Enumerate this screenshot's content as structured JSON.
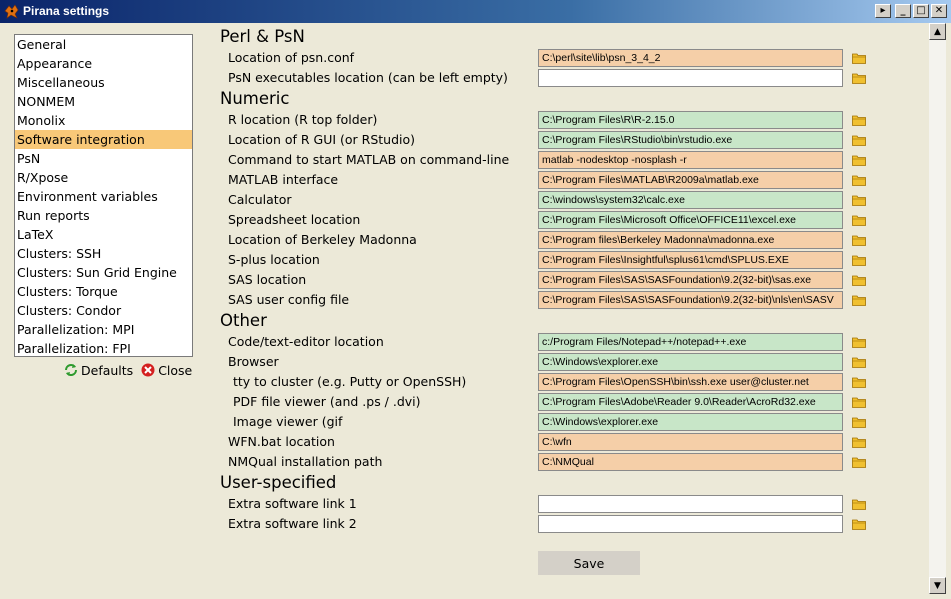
{
  "window": {
    "title": "Pirana settings",
    "buttons": {
      "arrow": "▸",
      "minimize": "_",
      "maximize": "□",
      "close": "✕"
    }
  },
  "sidebar": {
    "items": [
      {
        "label": "General"
      },
      {
        "label": "Appearance"
      },
      {
        "label": "Miscellaneous"
      },
      {
        "label": "NONMEM"
      },
      {
        "label": "Monolix"
      },
      {
        "label": "Software integration",
        "selected": true
      },
      {
        "label": "PsN"
      },
      {
        "label": "R/Xpose"
      },
      {
        "label": "Environment variables"
      },
      {
        "label": "Run reports"
      },
      {
        "label": "LaTeX"
      },
      {
        "label": "Clusters: SSH"
      },
      {
        "label": "Clusters: Sun Grid Engine"
      },
      {
        "label": "Clusters: Torque"
      },
      {
        "label": "Clusters: Condor"
      },
      {
        "label": "Parallelization: MPI"
      },
      {
        "label": "Parallelization: FPI"
      }
    ],
    "defaults_label": "Defaults",
    "close_label": "Close",
    "selection_color": "#f8c878"
  },
  "sections": {
    "perl": "Perl & PsN",
    "numeric": "Numeric",
    "other": "Other",
    "user": "User-specified"
  },
  "fields": {
    "psn_conf": {
      "label": "Location of psn.conf",
      "value": "C:\\perl\\site\\lib\\psn_3_4_2",
      "status": "orange"
    },
    "psn_exe": {
      "label": "PsN executables location (can be left empty)",
      "value": "",
      "status": "white"
    },
    "r_loc": {
      "label": "R location (R top folder)",
      "value": "C:\\Program Files\\R\\R-2.15.0",
      "status": "green"
    },
    "r_gui": {
      "label": "Location of R GUI (or RStudio)",
      "value": "C:\\Program Files\\RStudio\\bin\\rstudio.exe",
      "status": "green"
    },
    "matlab_cmd": {
      "label": "Command to start MATLAB on command-line",
      "value": "matlab -nodesktop -nosplash -r",
      "status": "orange"
    },
    "matlab_if": {
      "label": "MATLAB interface",
      "value": "C:\\Program Files\\MATLAB\\R2009a\\matlab.exe",
      "status": "orange"
    },
    "calculator": {
      "label": "Calculator",
      "value": "C:\\windows\\system32\\calc.exe",
      "status": "green"
    },
    "spreadsheet": {
      "label": "Spreadsheet location",
      "value": "C:\\Program Files\\Microsoft Office\\OFFICE11\\excel.exe",
      "status": "green"
    },
    "madonna": {
      "label": "Location of Berkeley Madonna",
      "value": "C:\\Program files\\Berkeley Madonna\\madonna.exe",
      "status": "orange"
    },
    "splus": {
      "label": "S-plus location",
      "value": "C:\\Program Files\\Insightful\\splus61\\cmd\\SPLUS.EXE",
      "status": "orange"
    },
    "sas": {
      "label": "SAS location",
      "value": "C:\\Program Files\\SAS\\SASFoundation\\9.2(32-bit)\\sas.exe",
      "status": "orange"
    },
    "sas_cfg": {
      "label": "SAS user config file",
      "value": "C:\\Program Files\\SAS\\SASFoundation\\9.2(32-bit)\\nls\\en\\SASV",
      "status": "orange"
    },
    "editor": {
      "label": "Code/text-editor location",
      "value": "c:/Program Files/Notepad++/notepad++.exe",
      "status": "green"
    },
    "browser": {
      "label": "Browser",
      "value": "C:\\Windows\\explorer.exe",
      "status": "green"
    },
    "tty": {
      "label": "tty to cluster (e.g. Putty or OpenSSH)",
      "value": "C:\\Program Files\\OpenSSH\\bin\\ssh.exe user@cluster.net",
      "status": "orange"
    },
    "pdf": {
      "label": "PDF file viewer (and .ps / .dvi)",
      "value": "C:\\Program Files\\Adobe\\Reader 9.0\\Reader\\AcroRd32.exe",
      "status": "green"
    },
    "image": {
      "label": "Image viewer (gif",
      "value": "C:\\Windows\\explorer.exe",
      "status": "green"
    },
    "wfn": {
      "label": "WFN.bat location",
      "value": "C:\\wfn",
      "status": "orange"
    },
    "nmqual": {
      "label": "NMQual installation path",
      "value": "C:\\NMQual",
      "status": "orange"
    },
    "extra1": {
      "label": "Extra software link 1",
      "value": "",
      "status": "white"
    },
    "extra2": {
      "label": "Extra software link 2",
      "value": "",
      "status": "white"
    }
  },
  "save_label": "Save",
  "colors": {
    "found": "#c8e6c8",
    "not_found": "#f5cfa8",
    "folder": "#f0c030"
  },
  "icons": {
    "folder": "folder-icon",
    "defaults": "refresh-icon",
    "close": "close-circle-icon",
    "app": "pirana-icon"
  }
}
